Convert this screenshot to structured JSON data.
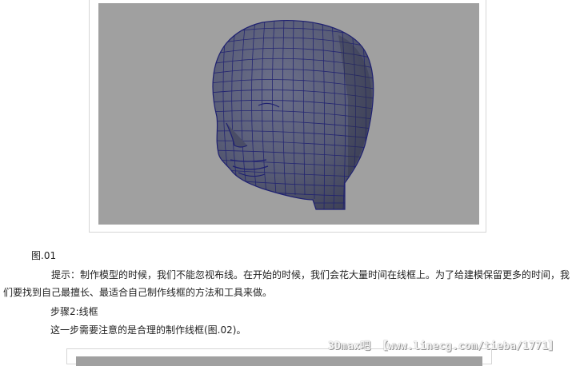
{
  "figure": {
    "caption": "图.01",
    "viewport_bg": "#a0a0a0",
    "model_fill": "#5a5e78",
    "wire_color": "#1e2070"
  },
  "article": {
    "tip": "提示：制作模型的时候，我们不能忽视布线。在开始的时候，我们会花大量时间在线框上。为了给建模保留更多的时间，我们要找到自己最擅长、最适合自己制作线框的方法和工具来做。",
    "step_title": "步骤2:线框",
    "step_text": "这一步需要注意的是合理的制作线框(图.02)。"
  },
  "watermark": "3Dmax吧 【www.linecg.com/tieba/1771】"
}
